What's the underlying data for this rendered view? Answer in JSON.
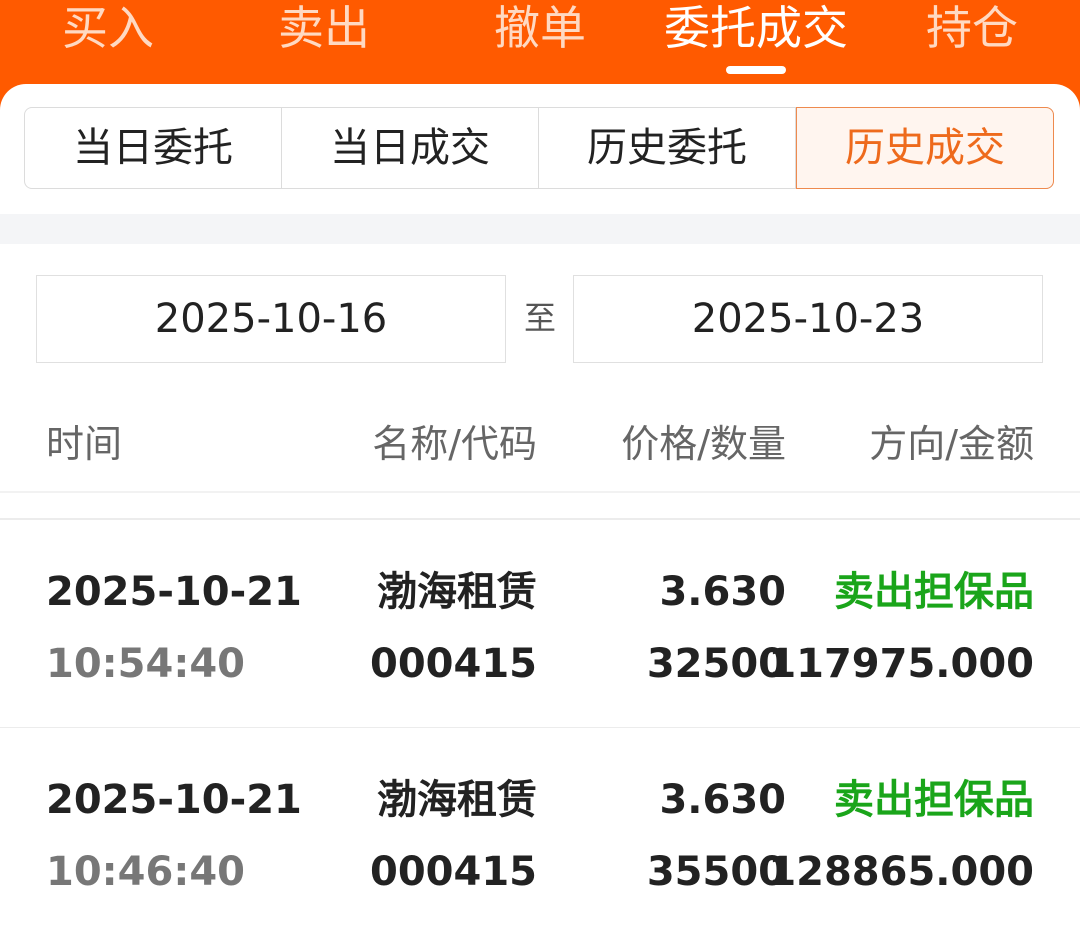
{
  "top_tabs": [
    {
      "label": "买入"
    },
    {
      "label": "卖出"
    },
    {
      "label": "撤单"
    },
    {
      "label": "委托成交"
    },
    {
      "label": "持仓"
    }
  ],
  "sub_tabs": [
    {
      "label": "当日委托"
    },
    {
      "label": "当日成交"
    },
    {
      "label": "历史委托"
    },
    {
      "label": "历史成交"
    }
  ],
  "date_range": {
    "start": "2025-10-16",
    "separator": "至",
    "end": "2025-10-23"
  },
  "columns": {
    "time": "时间",
    "name_code": "名称/代码",
    "price_qty": "价格/数量",
    "direction_amount": "方向/金额"
  },
  "trades": [
    {
      "date": "2025-10-21",
      "time": "10:54:40",
      "name": "渤海租赁",
      "code": "000415",
      "price": "3.630",
      "quantity": "32500",
      "direction": "卖出担保品",
      "amount": "117975.000"
    },
    {
      "date": "2025-10-21",
      "time": "10:46:40",
      "name": "渤海租赁",
      "code": "000415",
      "price": "3.630",
      "quantity": "35500",
      "direction": "卖出担保品",
      "amount": "128865.000"
    }
  ],
  "colors": {
    "brand_orange": "#ff5a00",
    "active_sub_tab": "#ee6a1c",
    "sell_direction": "#1aa51a"
  }
}
